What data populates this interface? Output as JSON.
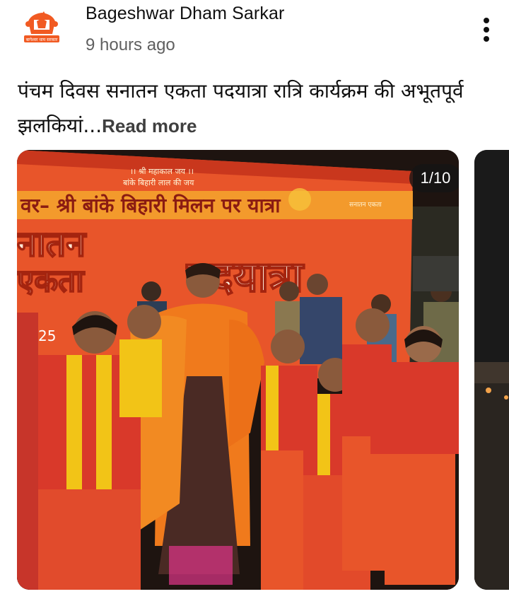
{
  "post": {
    "channel_name": "Bageshwar Dham Sarkar",
    "timestamp": "9 hours ago",
    "text": "पंचम दिवस सनातन एकता पदयात्रा रात्रि कार्यक्रम की अभूतपूर्व झलकियां...",
    "read_more_label": "Read more",
    "avatar_logo_text": "बागेश्वर धाम सरकार"
  },
  "carousel": {
    "counter": "1/10",
    "banner": {
      "line_top": "।। श्री महाकाल जय ।।",
      "line_top2": "बांके बिहारी लाल की जय",
      "line_main": "वर– श्री बांके बिहारी मिलन पर यात्रा",
      "line_right": "सनातन एकता",
      "line_big_left1": "नातन",
      "line_big_left2": "एकता",
      "line_big_right": "पदयात्रा",
      "date_fragment": "25"
    }
  },
  "colors": {
    "banner_orange": "#e8552a",
    "saffron_robe": "#f07a1c",
    "kids_red": "#d9392a",
    "kids_yellow": "#f2c417",
    "dark_bg": "#22150f"
  }
}
